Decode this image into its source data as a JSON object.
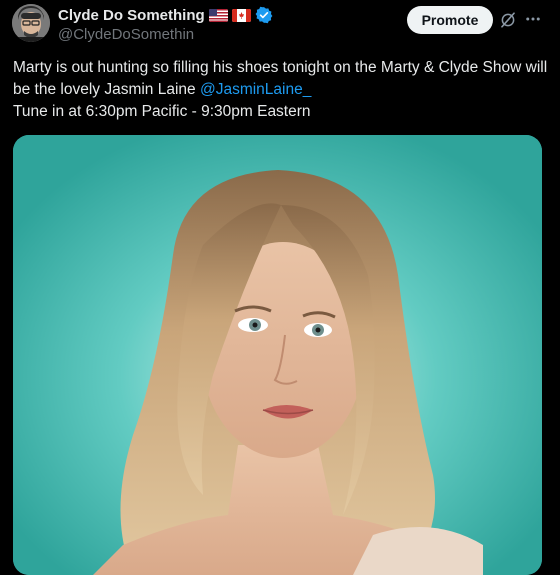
{
  "author": {
    "display_name": "Clyde Do Something",
    "handle": "@ClydeDoSomethin",
    "flags": [
      "us-flag-icon",
      "canada-flag-icon"
    ],
    "verified_icon": "verified-badge-icon"
  },
  "actions": {
    "promote_label": "Promote",
    "grok_icon": "grok-icon",
    "more_icon": "more-icon"
  },
  "tweet": {
    "text_line1": "Marty is out hunting so filling his shoes tonight on the Marty & Clyde Show will be the lovely Jasmin Laine ",
    "mention": "@JasminLaine_",
    "text_line2": "Tune in at 6:30pm Pacific - 9:30pm Eastern"
  },
  "media": {
    "kind": "photo",
    "background_color": "#4fc1b8"
  },
  "colors": {
    "background": "#000000",
    "text": "#e7e9ea",
    "secondary": "#71767b",
    "link": "#1d9bf0",
    "verified": "#1d9bf0"
  }
}
